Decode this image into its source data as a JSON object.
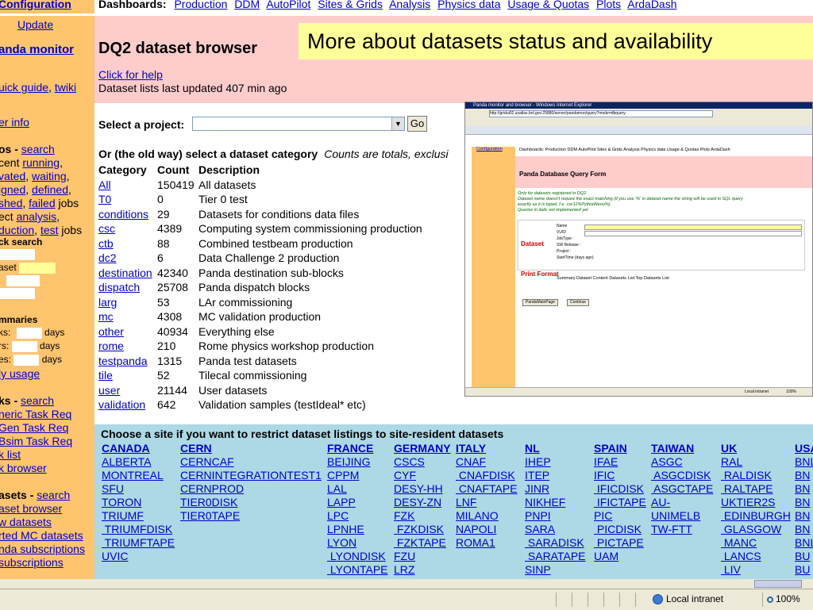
{
  "topbar": {
    "config_label": "Configuration",
    "dash_label": "Dashboards:",
    "links": [
      "Production",
      "DDM",
      "AutoPilot",
      "Sites & Grids",
      "Analysis",
      "Physics data",
      "Usage & Quotas",
      "Plots",
      "ArdaDash"
    ]
  },
  "sidebar": {
    "update": "Update",
    "monitor": "anda monitor",
    "quick_guide": "uick guide",
    "twiki": "twiki",
    "user_info": "er info",
    "jobs_label": "os - ",
    "jobs_search": "search",
    "recent": "cent ",
    "running": "running",
    "activated": "vated",
    "waiting": "waiting",
    "assigned": "igned",
    "defined": "defined",
    "finished": "shed",
    "failed": "failed",
    "jobs_word": " jobs",
    "select": "ect ",
    "analysis": "analysis",
    "production": "duction",
    "test": "test",
    "quick_search": "ck search",
    "dataset_lbl": "aset",
    "summaries": "mmaries",
    "blocks_lbl": "ks:",
    "errors_lbl": "rs:",
    "nodes_lbl": "es:",
    "days": "days",
    "daily_usage": "ly usage",
    "tasks_label": "ks - ",
    "tasks_search": "search",
    "generic_task": "neric Task Req",
    "evgen_task": "Gen Task Req",
    "ctbsim_task": "Bsim Task Req",
    "task_list": "k list",
    "task_browser": "k browser",
    "datasets_label": "asets - ",
    "datasets_search": "search",
    "dataset_browser": "aset browser",
    "new_datasets": "w datasets",
    "aborted_mc": "rted MC datasets",
    "panda_subs": "nda subscriptions",
    "all_subs": "subscriptions"
  },
  "main": {
    "title": "DQ2 dataset browser",
    "help": "Click for help",
    "updated": "Dataset lists last updated 407 min ago",
    "callout": "More about datasets status and availability",
    "select_project": "Select a project:",
    "go": "Go",
    "oldway": "Or (the old way) select a dataset category",
    "counts_note": "Counts are totals, exclusi",
    "headers": [
      "Category",
      "Count",
      "Description"
    ],
    "rows": [
      [
        "All",
        "150419",
        "All datasets"
      ],
      [
        "T0",
        "0",
        "Tier 0 test"
      ],
      [
        "conditions",
        "29",
        "Datasets for conditions data files"
      ],
      [
        "csc",
        "4389",
        "Computing system commissioning production"
      ],
      [
        "ctb",
        "88",
        "Combined testbeam production"
      ],
      [
        "dc2",
        "6",
        "Data Challenge 2 production"
      ],
      [
        "destination",
        "42340",
        "Panda destination sub-blocks"
      ],
      [
        "dispatch",
        "25708",
        "Panda dispatch blocks"
      ],
      [
        "larg",
        "53",
        "LAr commissioning"
      ],
      [
        "mc",
        "4308",
        "MC validation production"
      ],
      [
        "other",
        "40934",
        "Everything else"
      ],
      [
        "rome",
        "210",
        "Rome physics workshop production"
      ],
      [
        "testpanda",
        "1315",
        "Panda test datasets"
      ],
      [
        "tile",
        "52",
        "Tilecal commissioning"
      ],
      [
        "user",
        "21144",
        "User datasets"
      ],
      [
        "validation",
        "642",
        "Validation samples (testIdeal* etc)"
      ]
    ]
  },
  "embedded": {
    "window_title": "Panda monitor and browser - Windows Internet Explorer",
    "address": "http://gridui02.usatlas.bnl.gov:25880/server/pandamon/query?mode=dbquery",
    "page_title": "Panda Database Query Form",
    "config": "Configuration",
    "dash": "Dashboards: Production DDM AutoPilot Sites & Grids Analysis Physics data Usage & Quotas Plots ArdaDash",
    "notes": [
      "Only for datasets registered in DQ2",
      "Dataset name doesn't require the exact matching (if you use '%' in dataset name the string will be used in SQL query",
      "exactly as it is typed, f.e. csc11%PythiaWenu%)",
      "Queries in italic not implemented yet"
    ],
    "dataset_label": "Dataset",
    "print_label": "Print Format",
    "fields": [
      "Name",
      "VUID",
      "JobType :",
      "SW Release :",
      "Project :",
      "StartTime (days ago)"
    ],
    "print_options": "Summary  Dataset Content  Datasets List  Top Datasets List",
    "btn_main": "PandaMainPage",
    "btn_continue": "Continue",
    "status": "Local intranet",
    "zoom": "100%"
  },
  "sites": {
    "title": "Choose a site if you want to restrict dataset listings to site-resident datasets",
    "columns": [
      {
        "header": "CANADA",
        "items": [
          "ALBERTA",
          "MONTREAL",
          "SFU",
          "TORON",
          "TRIUMF",
          " TRIUMFDISK",
          " TRIUMFTAPE",
          "UVIC"
        ]
      },
      {
        "header": "CERN",
        "items": [
          "CERNCAF",
          "CERNINTEGRATIONTEST1",
          "CERNPROD",
          "TIER0DISK",
          "TIER0TAPE"
        ]
      },
      {
        "header": "FRANCE",
        "items": [
          "BEIJING",
          "CPPM",
          "LAL",
          "LAPP",
          "LPC",
          "LPNHE",
          "LYON",
          " LYONDISK",
          " LYONTAPE"
        ]
      },
      {
        "header": "GERMANY",
        "items": [
          "CSCS",
          "CYF",
          "DESY-HH",
          "DESY-ZN",
          "FZK",
          " FZKDISK",
          " FZKTAPE",
          "FZU",
          "LRZ"
        ]
      },
      {
        "header": "ITALY",
        "items": [
          "CNAF",
          " CNAFDISK",
          " CNAFTAPE",
          "LNF",
          "MILANO",
          "NAPOLI",
          "ROMA1"
        ]
      },
      {
        "header": "NL",
        "items": [
          "IHEP",
          "ITEP",
          "JINR",
          "NIKHEF",
          "PNPI",
          "SARA",
          " SARADISK",
          " SARATAPE",
          "SINP"
        ]
      },
      {
        "header": "SPAIN",
        "items": [
          "IFAE",
          "IFIC",
          " IFICDISK",
          " IFICTAPE",
          "PIC",
          " PICDISK",
          " PICTAPE",
          "UAM"
        ]
      },
      {
        "header": "TAIWAN",
        "items": [
          "ASGC",
          " ASGCDISK",
          " ASGCTAPE",
          "AU-",
          "UNIMELB",
          "TW-FTT"
        ]
      },
      {
        "header": "UK",
        "items": [
          "RAL",
          " RALDISK",
          " RALTAPE",
          "UKTIER2S",
          " EDINBURGH",
          " GLASGOW",
          " MANC",
          " LANCS",
          " LIV"
        ]
      },
      {
        "header": "USA",
        "items": [
          "BNL",
          "BN",
          "BN",
          "BN",
          "BN",
          "BN",
          "BNL",
          "BU",
          "BU"
        ]
      }
    ]
  },
  "statusbar": {
    "zone": "Local intranet",
    "zoom": "100%"
  }
}
